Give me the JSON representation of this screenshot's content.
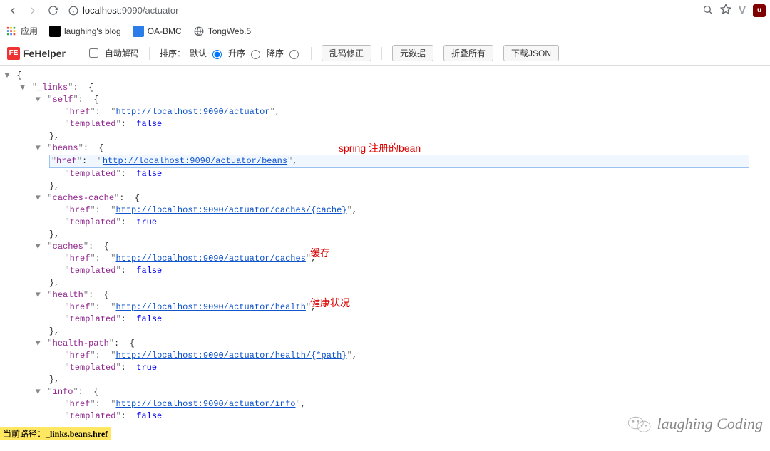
{
  "browser": {
    "url_host": "localhost",
    "url_path": ":9090/actuator",
    "bookmarks_label": "应用",
    "bookmarks": [
      {
        "name": "laughing's blog",
        "color": "#000"
      },
      {
        "name": "OA-BMC",
        "color": "#2b7de9"
      },
      {
        "name": "TongWeb.5",
        "color": "#888"
      }
    ]
  },
  "fehelper": {
    "brand": "FeHelper",
    "auto_decode": "自动解码",
    "sort_label": "排序：",
    "sort_default": "默认",
    "sort_asc": "升序",
    "sort_desc": "降序",
    "btn_fix": "乱码修正",
    "btn_meta": "元数据",
    "btn_collapse": "折叠所有",
    "btn_download": "下载JSON"
  },
  "json": {
    "root_key": "_links",
    "entries": [
      {
        "key": "self",
        "href": "http://localhost:9090/actuator",
        "templated": "false",
        "hl": false
      },
      {
        "key": "beans",
        "href": "http://localhost:9090/actuator/beans",
        "templated": "false",
        "hl": true,
        "annot": "spring 注册的bean"
      },
      {
        "key": "caches-cache",
        "href": "http://localhost:9090/actuator/caches/{cache}",
        "templated": "true",
        "hl": false
      },
      {
        "key": "caches",
        "href": "http://localhost:9090/actuator/caches",
        "templated": "false",
        "hl": false,
        "annot": "缓存"
      },
      {
        "key": "health",
        "href": "http://localhost:9090/actuator/health",
        "templated": "false",
        "hl": false,
        "annot": "健康状况"
      },
      {
        "key": "health-path",
        "href": "http://localhost:9090/actuator/health/{*path}",
        "templated": "true",
        "hl": false
      },
      {
        "key": "info",
        "href": "http://localhost:9090/actuator/info",
        "templated": "false",
        "hl": false
      }
    ]
  },
  "footer": {
    "path_label": "当前路径：",
    "path_value": "_links.beans.href"
  },
  "watermark": "laughing Coding"
}
